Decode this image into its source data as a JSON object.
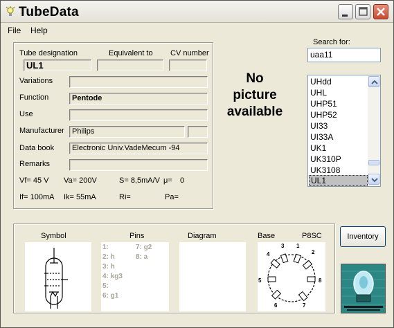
{
  "window": {
    "title": "TubeData"
  },
  "menu": {
    "file": "File",
    "help": "Help"
  },
  "main": {
    "tube_designation_label": "Tube designation",
    "equivalent_label": "Equivalent to",
    "cv_label": "CV number",
    "tube_designation": "UL1",
    "equivalent": "",
    "cv_number": "",
    "variations_label": "Variations",
    "variations": "",
    "function_label": "Function",
    "function": "Pentode",
    "use_label": "Use",
    "use": "",
    "manufacturer_label": "Manufacturer",
    "manufacturer": "Philips",
    "manufacturer_extra": "",
    "data_book_label": "Data book",
    "data_book": "Electronic Univ.VadeMecum -94",
    "remarks_label": "Remarks",
    "remarks": "",
    "vf": "Vf= 45 V",
    "va": "Va= 200V",
    "s": "S= 8,5mA/V",
    "mu": "μ=",
    "mu_value": "0",
    "if": "If= 100mA",
    "ik": "Ik= 55mA",
    "ri": "Ri=",
    "pa": "Pa="
  },
  "picture": {
    "no_picture_line1": "No",
    "no_picture_line2": "picture",
    "no_picture_line3": "available"
  },
  "search": {
    "label": "Search for:",
    "value": "uaa11"
  },
  "list": {
    "items": [
      "UHdd",
      "UHL",
      "UHP51",
      "UHP52",
      "UI33",
      "UI33A",
      "UK1",
      "UK310P",
      "UK3108",
      "UL1"
    ],
    "selected": "UL1"
  },
  "bottom": {
    "symbol_label": "Symbol",
    "pins_label": "Pins",
    "diagram_label": "Diagram",
    "base_label": "Base",
    "base_type": "P8SC",
    "pins_col1": [
      "1:",
      "2: h",
      "3: h",
      "4: kg3",
      "5:",
      "6: g1"
    ],
    "pins_col2": [
      "7: g2",
      "8: a"
    ],
    "base_pins": [
      "1",
      "2",
      "3",
      "4",
      "5",
      "6",
      "7",
      "8"
    ]
  },
  "buttons": {
    "inventory": "Inventory"
  },
  "icons": {
    "app": "lightbulb-icon",
    "minimize": "minimize-icon",
    "maximize": "maximize-icon",
    "close": "close-icon"
  },
  "colors": {
    "close_button": "#c64b30",
    "selection": "#c0c0c0",
    "logo_bg": "#2f8c8a"
  }
}
